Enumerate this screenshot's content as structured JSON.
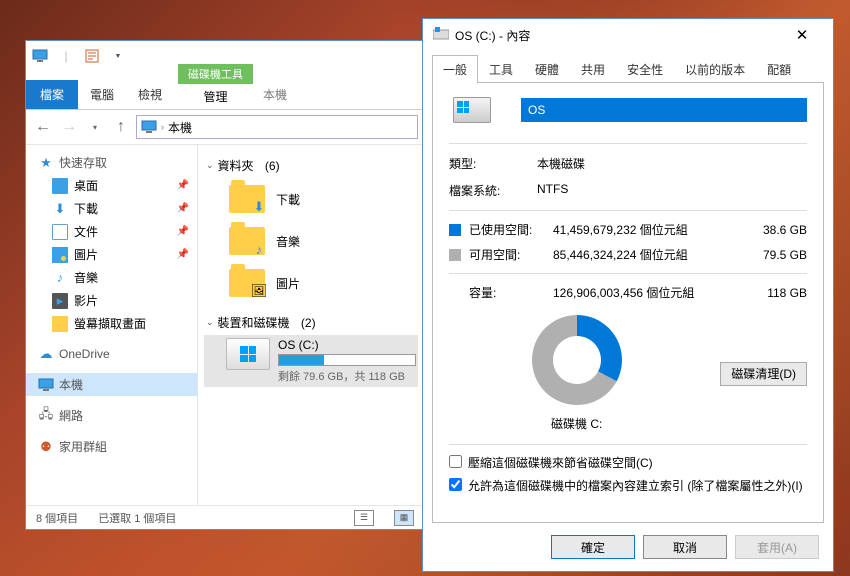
{
  "explorer": {
    "ribbon": {
      "file": "檔案",
      "tabs": [
        "電腦",
        "檢視"
      ],
      "tool_group_label": "磁碟機工具",
      "tool_tab": "管理",
      "context_label": "本機"
    },
    "address": {
      "location": "本機"
    },
    "sidebar": {
      "quick_access": "快速存取",
      "items": [
        {
          "label": "桌面",
          "icon": "desktop",
          "pinned": true
        },
        {
          "label": "下載",
          "icon": "download",
          "pinned": true
        },
        {
          "label": "文件",
          "icon": "doc",
          "pinned": true
        },
        {
          "label": "圖片",
          "icon": "pic",
          "pinned": true
        },
        {
          "label": "音樂",
          "icon": "music"
        },
        {
          "label": "影片",
          "icon": "video"
        },
        {
          "label": "螢幕擷取畫面",
          "icon": "capture"
        }
      ],
      "onedrive": "OneDrive",
      "this_pc": "本機",
      "network": "網路",
      "homegroup": "家用群組"
    },
    "content": {
      "folders_header": "資料夾",
      "folders_count": "(6)",
      "folders": [
        {
          "label": "下載",
          "sub_icon": "down-arrow-icon",
          "sub_glyph": "⬇",
          "sub_color": "#2f8dd6"
        },
        {
          "label": "音樂",
          "sub_icon": "music-note-icon",
          "sub_glyph": "♪",
          "sub_color": "#2f8dd6"
        },
        {
          "label": "圖片",
          "sub_icon": "picture-icon",
          "sub_glyph": "🖼",
          "sub_color": ""
        }
      ],
      "devices_header": "裝置和磁碟機",
      "devices_count": "(2)",
      "drive": {
        "name": "OS (C:)",
        "free_text": "剩餘 79.6 GB，共 118 GB",
        "fill_percent": 33
      }
    },
    "status": {
      "item_count": "8 個項目",
      "selection": "已選取 1 個項目"
    }
  },
  "props": {
    "title": "OS (C:) - 內容",
    "tabs": [
      "一般",
      "工具",
      "硬體",
      "共用",
      "安全性",
      "以前的版本",
      "配額"
    ],
    "active_tab": 0,
    "name_value": "OS",
    "type_label": "類型:",
    "type_value": "本機磁碟",
    "fs_label": "檔案系統:",
    "fs_value": "NTFS",
    "used": {
      "label": "已使用空間:",
      "bytes": "41,459,679,232 個位元組",
      "gb": "38.6 GB",
      "color": "#0078d7"
    },
    "free": {
      "label": "可用空間:",
      "bytes": "85,446,324,224 個位元組",
      "gb": "79.5 GB",
      "color": "#b0b0b0"
    },
    "capacity": {
      "label": "容量:",
      "bytes": "126,906,003,456 個位元組",
      "gb": "118 GB"
    },
    "donut_label": "磁碟機 C:",
    "cleanup_button": "磁碟清理(D)",
    "compress_label": "壓縮這個磁碟機來節省磁碟空間(C)",
    "index_label": "允許為這個磁碟機中的檔案內容建立索引 (除了檔案屬性之外)(I)",
    "buttons": {
      "ok": "確定",
      "cancel": "取消",
      "apply": "套用(A)"
    }
  },
  "chart_data": {
    "type": "pie",
    "title": "磁碟機 C:",
    "categories": [
      "已使用空間",
      "可用空間"
    ],
    "values": [
      38.6,
      79.5
    ],
    "unit": "GB",
    "colors": [
      "#0078d7",
      "#b0b0b0"
    ]
  }
}
